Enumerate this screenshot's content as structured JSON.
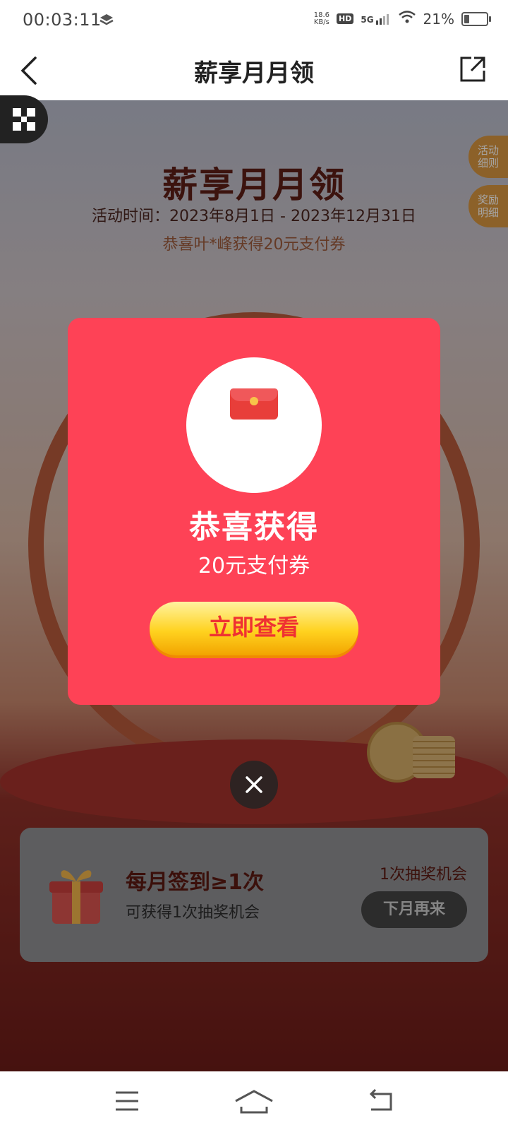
{
  "status_bar": {
    "time": "00:03:11",
    "net_speed_value": "18.6",
    "net_speed_unit": "KB/s",
    "hd_label": "HD",
    "network_label": "5G",
    "battery_percent": "21%"
  },
  "header": {
    "title": "薪享月月领"
  },
  "page": {
    "headline": "薪享月月领",
    "period": "活动时间：2023年8月1日 - 2023年12月31日",
    "winner_notice": "恭喜叶*峰获得20元支付券"
  },
  "side_tabs": {
    "rules": "活动细则",
    "reward_detail": "奖励明细"
  },
  "task_card": {
    "title": "每月签到≥1次",
    "description": "可获得1次抽奖机会",
    "reward": "1次抽奖机会",
    "button": "下月再来"
  },
  "modal": {
    "title": "恭喜获得",
    "prize": "20元支付券",
    "cta": "立即查看"
  },
  "colors": {
    "modal_bg": "#fe4256",
    "cta_text": "#ef3132",
    "headline": "#5d1e16"
  }
}
